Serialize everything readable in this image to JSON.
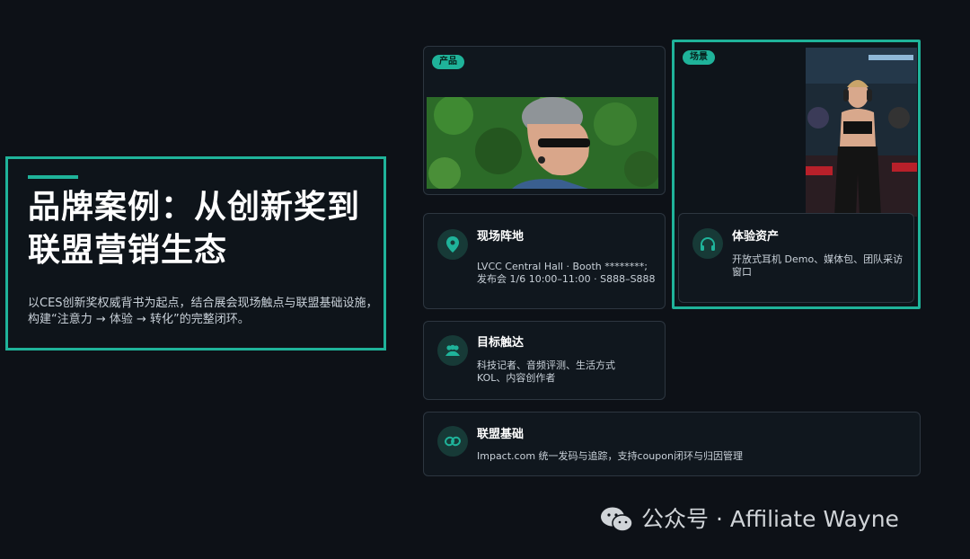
{
  "hero": {
    "title": "品牌案例：从创新奖到联盟营销生态",
    "subtitle": "以CES创新奖权威背书为起点，结合展会现场触点与联盟基础设施，构建“注意力 → 体验 → 转化”的完整闭环。"
  },
  "product_card": {
    "tag": "产品"
  },
  "scene_card": {
    "tag": "场景"
  },
  "venue_card": {
    "title": "现场阵地",
    "line1": "LVCC Central Hall · Booth ********;",
    "line2": "发布会 1/6 10:00–11:00 · S888–S888",
    "icon": "location-pin-icon"
  },
  "experience_card": {
    "title": "体验资产",
    "line1": "开放式耳机 Demo、媒体包、团队采访",
    "line2": "窗口",
    "icon": "headphones-icon"
  },
  "audience_card": {
    "title": "目标触达",
    "line1": "科技记者、音频评测、生活方式",
    "line2": "KOL、内容创作者",
    "icon": "users-icon"
  },
  "affiliate_card": {
    "title": "联盟基础",
    "line1": "Impact.com 统一发码与追踪，支持coupon闭环与归因管理",
    "icon": "link-icon"
  },
  "watermark": {
    "text": "公众号 · Affiliate Wayne",
    "icon": "wechat-icon"
  },
  "colors": {
    "accent": "#1fb39a",
    "background": "#0d1117",
    "card": "#10171e"
  }
}
